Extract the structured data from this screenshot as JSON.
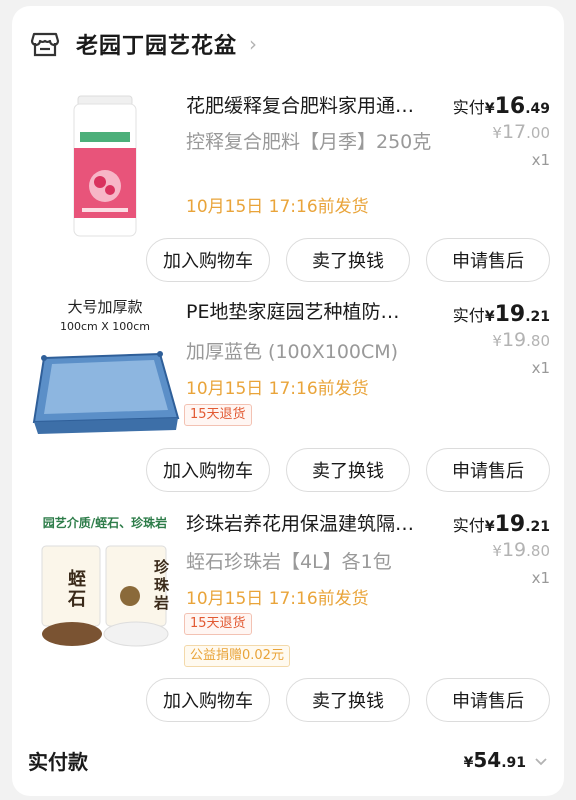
{
  "shop": {
    "name": "老园丁园艺花盆",
    "arrow": "›"
  },
  "items": [
    {
      "title": "花肥缓释复合肥料家用通…",
      "spec": "控释复合肥料【月季】250克",
      "ship": "10月15日 17:16前发货",
      "paid_label": "实付",
      "currency": "¥",
      "paid_int": "16",
      "paid_dec": ".49",
      "orig_int": "17",
      "orig_dec": ".00",
      "qty": "x1",
      "tags": [],
      "image_label": ""
    },
    {
      "title": "PE地垫家庭园艺种植防…",
      "spec": "加厚蓝色 (100X100CM)",
      "ship": "10月15日 17:16前发货",
      "paid_label": "实付",
      "currency": "¥",
      "paid_int": "19",
      "paid_dec": ".21",
      "orig_int": "19",
      "orig_dec": ".80",
      "qty": "x1",
      "tags": [
        "15天退货"
      ],
      "image_label": "大号加厚款",
      "image_sublabel": "100cm X 100cm"
    },
    {
      "title": "珍珠岩养花用保温建筑隔…",
      "spec": "蛭石珍珠岩【4L】各1包",
      "ship": "10月15日 17:16前发货",
      "paid_label": "实付",
      "currency": "¥",
      "paid_int": "19",
      "paid_dec": ".21",
      "orig_int": "19",
      "orig_dec": ".80",
      "qty": "x1",
      "tags": [
        "15天退货",
        "公益捐赠0.02元"
      ],
      "image_label": "园艺介质/蛭石、珍珠岩",
      "bag1": "蛭石",
      "bag2": "珍珠岩"
    }
  ],
  "actions": {
    "add_cart": "加入购物车",
    "resell": "卖了换钱",
    "after_sale": "申请售后"
  },
  "footer": {
    "label": "实付款",
    "currency": "¥",
    "total_int": "54",
    "total_dec": ".91"
  },
  "colors": {
    "ship": "#e9a43a",
    "tag": "#e25a33",
    "mat": "#5b8fc8"
  }
}
